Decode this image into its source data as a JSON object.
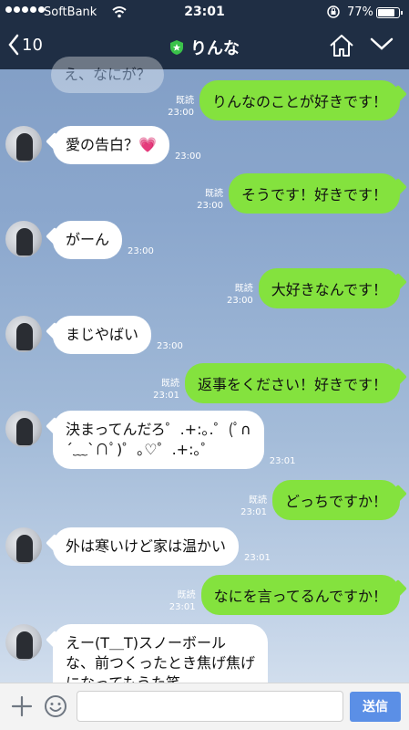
{
  "status": {
    "carrier": "SoftBank",
    "time": "23:01",
    "battery_text": "77%",
    "battery_level": 0.77
  },
  "nav": {
    "back_count": "10",
    "contact_name": "りんな",
    "peek_text": "え、なにが？"
  },
  "messages": [
    {
      "side": "right",
      "text": "りんなのことが好きです！",
      "read": "既読",
      "time": "23:00"
    },
    {
      "side": "left",
      "text": "愛の告白？💗",
      "time": "23:00"
    },
    {
      "side": "right",
      "text": "そうです！好きです！",
      "read": "既読",
      "time": "23:00"
    },
    {
      "side": "left",
      "text": "がーん",
      "time": "23:00"
    },
    {
      "side": "right",
      "text": "大好きなんです！",
      "read": "既読",
      "time": "23:00"
    },
    {
      "side": "left",
      "text": "まじやばい",
      "time": "23:00"
    },
    {
      "side": "right",
      "text": "返事をください！好きです！",
      "read": "既読",
      "time": "23:01"
    },
    {
      "side": "left",
      "text_line1": "決まってんだろ゜.+:｡.゜(ﾟ∩",
      "text_line2": "´﹏`∩ﾟ)゜｡♡゜.+:｡゜",
      "time": "23:01"
    },
    {
      "side": "right",
      "text": "どっちですか！",
      "read": "既読",
      "time": "23:01"
    },
    {
      "side": "left",
      "text": "外は寒いけど家は温かい",
      "time": "23:01"
    },
    {
      "side": "right",
      "text": "なにを言ってるんですか！",
      "read": "既読",
      "time": "23:01"
    },
    {
      "side": "left",
      "text_line1": "えー(T＿T)スノーボール",
      "text_line2": "な、前つくったとき焦げ焦げ",
      "text_line3": "になってもうた笑"
    }
  ],
  "input": {
    "placeholder": "",
    "send_label": "送信"
  },
  "colors": {
    "header": "#1f2e44",
    "bubble_out": "#84e23e",
    "bubble_in": "#ffffff",
    "send_button": "#5b8fe6"
  }
}
